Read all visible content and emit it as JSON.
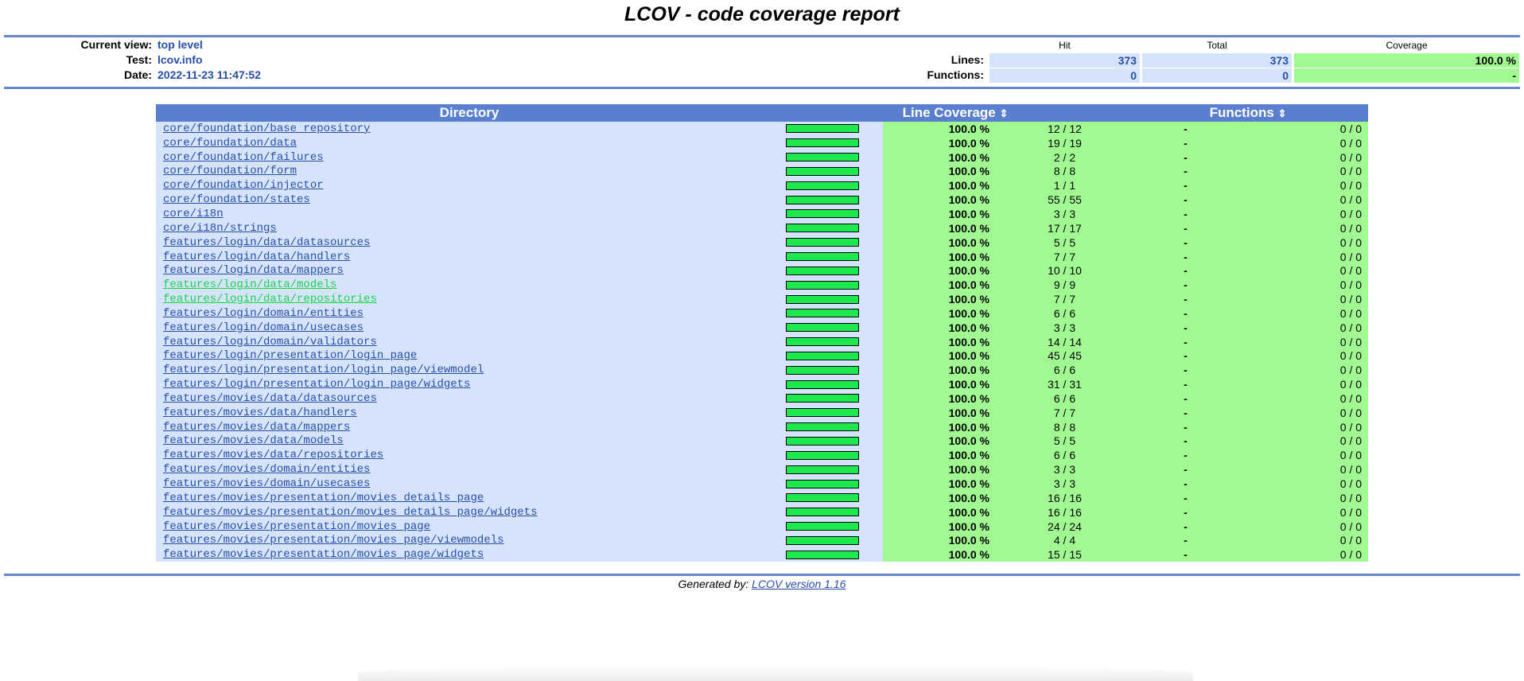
{
  "title": "LCOV - code coverage report",
  "info": {
    "current_view_label": "Current view:",
    "current_view": "top level",
    "test_label": "Test:",
    "test": "lcov.info",
    "date_label": "Date:",
    "date": "2022-11-23 11:47:52"
  },
  "summary": {
    "headers": {
      "hit": "Hit",
      "total": "Total",
      "coverage": "Coverage"
    },
    "lines": {
      "label": "Lines:",
      "hit": "373",
      "total": "373",
      "coverage": "100.0 %"
    },
    "functions": {
      "label": "Functions:",
      "hit": "0",
      "total": "0",
      "coverage": "-"
    }
  },
  "table": {
    "headers": {
      "directory": "Directory",
      "line_coverage": "Line Coverage",
      "functions": "Functions",
      "sort_icon": "⇕"
    },
    "colors": {
      "header": "#5b7fcf",
      "row": "#d6e3fc",
      "good": "#a0fa91",
      "bar": "#1de84c"
    },
    "rows": [
      {
        "dir": "core/foundation/base_repository",
        "fill": 100,
        "pct": "100.0 %",
        "lines": "12 / 12",
        "fpct": "-",
        "funcs": "0 / 0"
      },
      {
        "dir": "core/foundation/data",
        "fill": 100,
        "pct": "100.0 %",
        "lines": "19 / 19",
        "fpct": "-",
        "funcs": "0 / 0"
      },
      {
        "dir": "core/foundation/failures",
        "fill": 100,
        "pct": "100.0 %",
        "lines": "2 / 2",
        "fpct": "-",
        "funcs": "0 / 0"
      },
      {
        "dir": "core/foundation/form",
        "fill": 100,
        "pct": "100.0 %",
        "lines": "8 / 8",
        "fpct": "-",
        "funcs": "0 / 0"
      },
      {
        "dir": "core/foundation/injector",
        "fill": 100,
        "pct": "100.0 %",
        "lines": "1 / 1",
        "fpct": "-",
        "funcs": "0 / 0"
      },
      {
        "dir": "core/foundation/states",
        "fill": 100,
        "pct": "100.0 %",
        "lines": "55 / 55",
        "fpct": "-",
        "funcs": "0 / 0"
      },
      {
        "dir": "core/i18n",
        "fill": 100,
        "pct": "100.0 %",
        "lines": "3 / 3",
        "fpct": "-",
        "funcs": "0 / 0"
      },
      {
        "dir": "core/i18n/strings",
        "fill": 100,
        "pct": "100.0 %",
        "lines": "17 / 17",
        "fpct": "-",
        "funcs": "0 / 0"
      },
      {
        "dir": "features/login/data/datasources",
        "fill": 100,
        "pct": "100.0 %",
        "lines": "5 / 5",
        "fpct": "-",
        "funcs": "0 / 0"
      },
      {
        "dir": "features/login/data/handlers",
        "fill": 100,
        "pct": "100.0 %",
        "lines": "7 / 7",
        "fpct": "-",
        "funcs": "0 / 0"
      },
      {
        "dir": "features/login/data/mappers",
        "fill": 100,
        "pct": "100.0 %",
        "lines": "10 / 10",
        "fpct": "-",
        "funcs": "0 / 0"
      },
      {
        "dir": "features/login/data/models",
        "fill": 100,
        "pct": "100.0 %",
        "lines": "9 / 9",
        "fpct": "-",
        "funcs": "0 / 0",
        "visited": true
      },
      {
        "dir": "features/login/data/repositories",
        "fill": 100,
        "pct": "100.0 %",
        "lines": "7 / 7",
        "fpct": "-",
        "funcs": "0 / 0",
        "visited": true
      },
      {
        "dir": "features/login/domain/entities",
        "fill": 100,
        "pct": "100.0 %",
        "lines": "6 / 6",
        "fpct": "-",
        "funcs": "0 / 0"
      },
      {
        "dir": "features/login/domain/usecases",
        "fill": 100,
        "pct": "100.0 %",
        "lines": "3 / 3",
        "fpct": "-",
        "funcs": "0 / 0"
      },
      {
        "dir": "features/login/domain/validators",
        "fill": 100,
        "pct": "100.0 %",
        "lines": "14 / 14",
        "fpct": "-",
        "funcs": "0 / 0"
      },
      {
        "dir": "features/login/presentation/login_page",
        "fill": 100,
        "pct": "100.0 %",
        "lines": "45 / 45",
        "fpct": "-",
        "funcs": "0 / 0"
      },
      {
        "dir": "features/login/presentation/login_page/viewmodel",
        "fill": 100,
        "pct": "100.0 %",
        "lines": "6 / 6",
        "fpct": "-",
        "funcs": "0 / 0"
      },
      {
        "dir": "features/login/presentation/login_page/widgets",
        "fill": 100,
        "pct": "100.0 %",
        "lines": "31 / 31",
        "fpct": "-",
        "funcs": "0 / 0"
      },
      {
        "dir": "features/movies/data/datasources",
        "fill": 100,
        "pct": "100.0 %",
        "lines": "6 / 6",
        "fpct": "-",
        "funcs": "0 / 0"
      },
      {
        "dir": "features/movies/data/handlers",
        "fill": 100,
        "pct": "100.0 %",
        "lines": "7 / 7",
        "fpct": "-",
        "funcs": "0 / 0"
      },
      {
        "dir": "features/movies/data/mappers",
        "fill": 100,
        "pct": "100.0 %",
        "lines": "8 / 8",
        "fpct": "-",
        "funcs": "0 / 0"
      },
      {
        "dir": "features/movies/data/models",
        "fill": 100,
        "pct": "100.0 %",
        "lines": "5 / 5",
        "fpct": "-",
        "funcs": "0 / 0"
      },
      {
        "dir": "features/movies/data/repositories",
        "fill": 100,
        "pct": "100.0 %",
        "lines": "6 / 6",
        "fpct": "-",
        "funcs": "0 / 0"
      },
      {
        "dir": "features/movies/domain/entities",
        "fill": 100,
        "pct": "100.0 %",
        "lines": "3 / 3",
        "fpct": "-",
        "funcs": "0 / 0"
      },
      {
        "dir": "features/movies/domain/usecases",
        "fill": 100,
        "pct": "100.0 %",
        "lines": "3 / 3",
        "fpct": "-",
        "funcs": "0 / 0"
      },
      {
        "dir": "features/movies/presentation/movies_details_page",
        "fill": 100,
        "pct": "100.0 %",
        "lines": "16 / 16",
        "fpct": "-",
        "funcs": "0 / 0"
      },
      {
        "dir": "features/movies/presentation/movies_details_page/widgets",
        "fill": 100,
        "pct": "100.0 %",
        "lines": "16 / 16",
        "fpct": "-",
        "funcs": "0 / 0"
      },
      {
        "dir": "features/movies/presentation/movies_page",
        "fill": 100,
        "pct": "100.0 %",
        "lines": "24 / 24",
        "fpct": "-",
        "funcs": "0 / 0"
      },
      {
        "dir": "features/movies/presentation/movies_page/viewmodels",
        "fill": 100,
        "pct": "100.0 %",
        "lines": "4 / 4",
        "fpct": "-",
        "funcs": "0 / 0"
      },
      {
        "dir": "features/movies/presentation/movies_page/widgets",
        "fill": 100,
        "pct": "100.0 %",
        "lines": "15 / 15",
        "fpct": "-",
        "funcs": "0 / 0"
      }
    ]
  },
  "footer": {
    "prefix": "Generated by: ",
    "link": "LCOV version 1.16"
  }
}
